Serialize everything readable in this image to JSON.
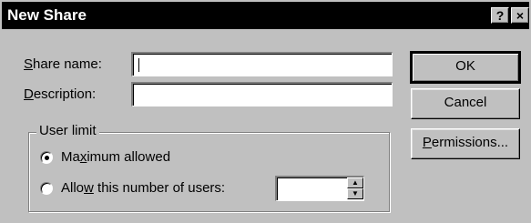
{
  "window": {
    "title": "New Share",
    "help_button": "?",
    "close_button": "×"
  },
  "fields": {
    "share_name_label": "Share name:",
    "share_name_value": "",
    "description_label": "Description:",
    "description_value": ""
  },
  "buttons": {
    "ok": "OK",
    "cancel": "Cancel",
    "permissions": "Permissions..."
  },
  "user_limit": {
    "group_label": "User limit",
    "maximum_allowed": "Maximum allowed",
    "allow_number": "Allow this number of users:",
    "selected": "maximum_allowed",
    "user_count": ""
  },
  "colors": {
    "face": "#c0c0c0",
    "titlebar": "#000000",
    "title_text": "#ffffff"
  },
  "icons": {
    "spin_up": "▲",
    "spin_down": "▼"
  }
}
